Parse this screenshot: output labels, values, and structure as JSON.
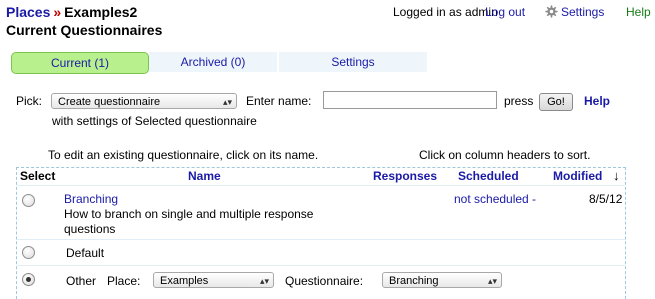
{
  "header": {
    "breadcrumb_places": "Places",
    "breadcrumb_sep": "»",
    "breadcrumb_current": "Examples2",
    "page_title": "Current Questionnaires",
    "logged_in": "Logged in as admin",
    "logout": "Log out",
    "settings": "Settings",
    "help": "Help"
  },
  "tabs": [
    {
      "label": "Current (1)",
      "active": true
    },
    {
      "label": "Archived (0)",
      "active": false
    },
    {
      "label": "Settings",
      "active": false
    }
  ],
  "pick": {
    "label": "Pick:",
    "select_value": "Create questionnaire",
    "enter_name_label": "Enter name:",
    "name_value": "",
    "press_label": "press",
    "go_button": "Go!",
    "help_link": "Help",
    "settings_note": "with settings of Selected questionnaire"
  },
  "instructions": {
    "edit": "To edit an existing questionnaire, click on its name.",
    "sort": "Click on column headers to sort."
  },
  "table": {
    "headers": {
      "select": "Select",
      "name": "Name",
      "responses": "Responses",
      "scheduled": "Scheduled",
      "modified": "Modified",
      "sort_arrow": "↓"
    },
    "rows": [
      {
        "name": "Branching",
        "description": "How to branch on single and multiple response questions",
        "scheduled": "not scheduled -",
        "modified": "8/5/12",
        "selected": false
      }
    ],
    "default_label": "Default",
    "other": {
      "label": "Other",
      "place_label": "Place:",
      "place_value": "Examples",
      "questionnaire_label": "Questionnaire:",
      "questionnaire_value": "Branching",
      "selected": true
    }
  },
  "colors": {
    "link": "#1a1aa6",
    "active_tab": "#b9f08e",
    "help_green": "#1a7a1a",
    "breadcrumb_sep": "#c00000"
  }
}
